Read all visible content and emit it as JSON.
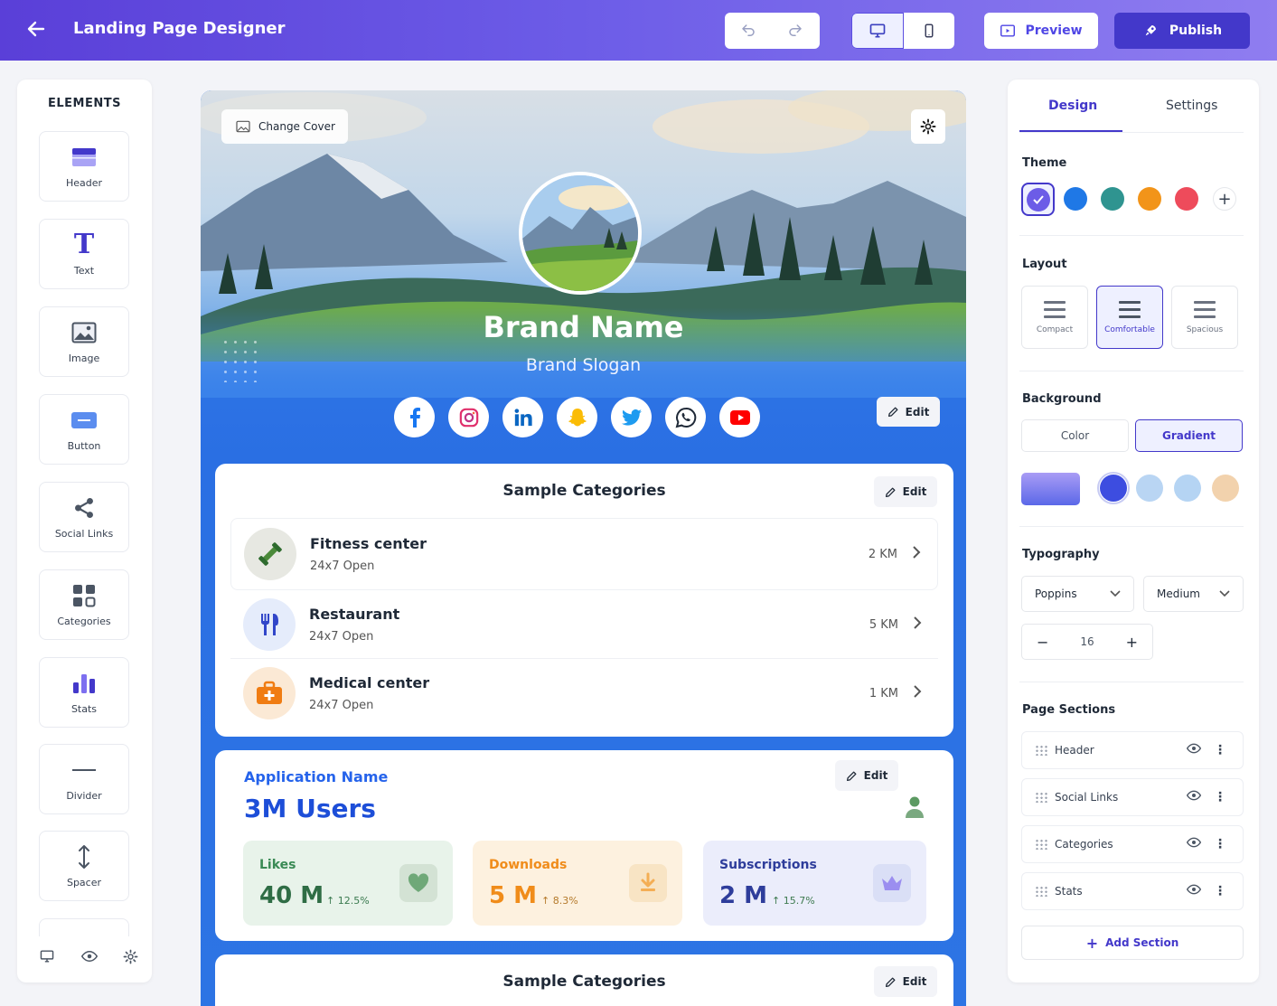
{
  "header": {
    "title": "Landing Page Designer",
    "preview_label": "Preview",
    "publish_label": "Publish"
  },
  "elements": {
    "title": "ELEMENTS",
    "items": [
      {
        "label": "Header",
        "icon": "header-icon"
      },
      {
        "label": "Text",
        "icon": "text-icon"
      },
      {
        "label": "Image",
        "icon": "image-icon"
      },
      {
        "label": "Button",
        "icon": "button-icon"
      },
      {
        "label": "Social Links",
        "icon": "share-icon"
      },
      {
        "label": "Categories",
        "icon": "grid-icon"
      },
      {
        "label": "Stats",
        "icon": "bar-chart-icon"
      },
      {
        "label": "Divider",
        "icon": "divider-icon"
      },
      {
        "label": "Spacer",
        "icon": "vertical-arrows-icon"
      }
    ]
  },
  "canvas": {
    "change_cover_label": "Change Cover",
    "brand_name": "Brand Name",
    "brand_slogan": "Brand Slogan",
    "edit_label": "Edit",
    "socials": [
      "facebook-icon",
      "instagram-icon",
      "linkedin-icon",
      "snapchat-icon",
      "twitter-icon",
      "whatsapp-icon",
      "youtube-icon"
    ],
    "categories_card": {
      "title": "Sample Categories",
      "items": [
        {
          "name": "Fitness center",
          "hours": "24x7 Open",
          "distance": "2 KM"
        },
        {
          "name": "Restaurant",
          "hours": "24x7 Open",
          "distance": "5 KM"
        },
        {
          "name": "Medical center",
          "hours": "24x7 Open",
          "distance": "1 KM"
        }
      ]
    },
    "stats_card": {
      "app_name": "Application Name",
      "users": "3M Users",
      "stats": [
        {
          "label": "Likes",
          "value": "40 M",
          "change": "12.5%",
          "color": "#3a8a55",
          "bg": "#e8f3ea"
        },
        {
          "label": "Downloads",
          "value": "5 M",
          "change": "8.3%",
          "color": "#f08c1a",
          "bg": "#fdf1df"
        },
        {
          "label": "Subscriptions",
          "value": "2 M",
          "change": "15.7%",
          "color": "#2e3d9b",
          "bg": "#ebedfb"
        }
      ]
    },
    "categories_card_2": {
      "title": "Sample Categories"
    }
  },
  "panel": {
    "tabs": [
      "Design",
      "Settings"
    ],
    "theme_label": "Theme",
    "theme_colors": [
      "#6c5ce7",
      "#1f78e6",
      "#2f9490",
      "#f29419",
      "#ee4b5b"
    ],
    "layout_label": "Layout",
    "layouts": [
      "Compact",
      "Comfortable",
      "Spacious"
    ],
    "layout_selected": "Comfortable",
    "background_label": "Background",
    "background_options": [
      "Color",
      "Gradient"
    ],
    "background_selected": "Gradient",
    "background_swatches": [
      "#3d4de0",
      "#b9d5f3",
      "#b5d4f3",
      "#f2d2ad"
    ],
    "typography_label": "Typography",
    "font_family": "Poppins",
    "font_weight": "Medium",
    "font_size": "16",
    "page_sections_label": "Page Sections",
    "sections": [
      "Header",
      "Social Links",
      "Categories",
      "Stats"
    ],
    "add_section_label": "Add Section"
  }
}
